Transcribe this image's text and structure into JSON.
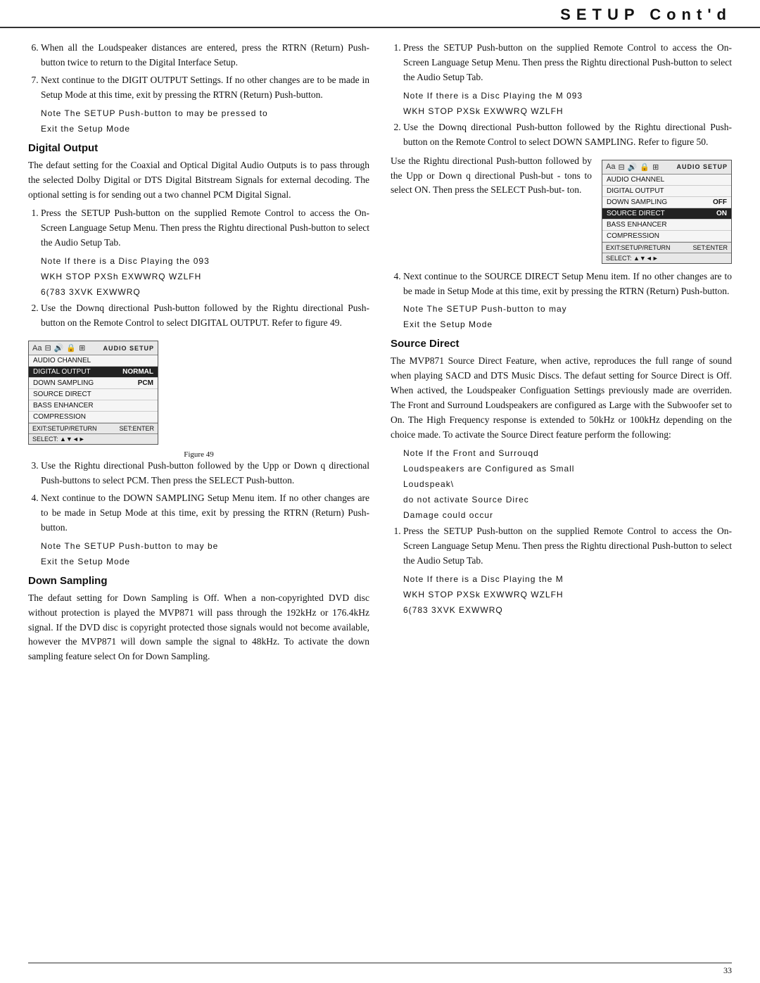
{
  "header": {
    "title": "SETUP  Cont'd"
  },
  "footer": {
    "page_number": "33"
  },
  "left_col": {
    "intro_items": [
      "When all the Loudspeaker distances are entered, press the RTRN (Return) Push-button twice to return to the Digital Interface Setup.",
      "Next continue to the DIGIT OUTPUT Settings. If no other changes are to be made in Setup Mode at this time, exit by pressing the RTRN (Return) Push-button."
    ],
    "note1_lines": [
      "Note  The SETUP Push-button to may be pressed to",
      "Exit the Setup Mode"
    ],
    "digital_output_heading": "Digital Output",
    "digital_output_body": "The defaut setting for the Coaxial and Optical Digital Audio Outputs is to pass through the selected Dolby Digital or DTS Digital Bitstream Signals for external decoding. The optional setting is for sending out a two channel PCM Digital Signal.",
    "steps_digital": [
      "Press the SETUP Push-button on the supplied Remote Control to access the On-Screen Language Setup Menu. Then press the Rightu directional Push-button to select the Audio Setup Tab.",
      "Use the Downq directional Push-button followed by the Rightu directional Push-button on the Remote Control to select DIGITAL OUTPUT. Refer to figure 49.",
      "Use the Rightu directional Push-button followed by the Upp or Down q directional Push-buttons to select PCM. Then press the SELECT Push-button.",
      "Next continue to the DOWN SAMPLING Setup Menu item. If no other changes are to be made in Setup Mode at this time, exit by pressing the RTRN (Return) Push-button."
    ],
    "note2_lines": [
      "Note  The SETUP Push-button to may be",
      "Exit the Setup Mode"
    ],
    "down_sampling_heading": "Down Sampling",
    "down_sampling_body": "The defaut setting for Down Sampling is Off. When a non-copyrighted DVD disc without protection is played the MVP871 will pass through the 192kHz or 176.4kHz signal. If the DVD disc is copyright protected those signals would not become available, however the MVP871 will down sample the signal to 48kHz. To activate the down sampling feature select On for Down Sampling.",
    "note1_detail_1": "Note  If there is a Disc Playing the 093",
    "note1_detail_2": "WKH STOP PXSh EXWWRQ WZLFH",
    "note1_detail_3": "6(783 3XVK EXWWRQ",
    "figure49_label": "Figure 49",
    "osd_left": {
      "header_label": "AUDIO SETUP",
      "rows": [
        {
          "label": "AUDIO CHANNEL",
          "value": "",
          "highlight": false
        },
        {
          "label": "DIGITAL OUTPUT",
          "value": "NORMAL",
          "highlight": true
        },
        {
          "label": "DOWN SAMPLING",
          "value": "PCM",
          "highlight": false
        },
        {
          "label": "SOURCE DIRECT",
          "value": "",
          "highlight": false
        },
        {
          "label": "BASS ENHANCER",
          "value": "",
          "highlight": false
        },
        {
          "label": "COMPRESSION",
          "value": "",
          "highlight": false
        }
      ],
      "footer_left": "EXIT:SETUP/RETURN",
      "footer_right": "SET:ENTER",
      "select_label": "SELECT: ▲▼◄►"
    }
  },
  "right_col": {
    "intro": "Press the SETUP Push-button on the supplied Remote Control to access the On-Screen Language Setup Menu. Then press the Rightu directional Push-button to select the Audio Setup Tab.",
    "note_r1_lines": [
      "Note  If there is a Disc Playing the M 093",
      "WKH STOP PXSk EXWWRQ WZLFH"
    ],
    "step2": "Use the Downq directional Push-button followed by the Rightu directional Push-button on the Remote Control to select DOWN SAMPLING. Refer to figure 50.",
    "step3": "Use the Rightu directional Push-button followed by the Upp or Down q directional Push-but - tons to select ON. Then press the SELECT Push-but- ton.",
    "step4": "Next continue to the SOURCE DIRECT Setup Menu item. If no other changes are to be made in Setup Mode at this time, exit by pressing the RTRN (Return) Push-button.",
    "note_r2_lines": [
      "Note  The SETUP Push-button to may",
      "Exit the Setup Mode"
    ],
    "source_direct_heading": "Source Direct",
    "source_direct_body": "The MVP871 Source Direct Feature, when active, reproduces the full range of sound when playing SACD and DTS Music Discs. The defaut setting for Source Direct is Off. When actived, the Loudspeaker Configuation Settings previously made are overriden. The Front and Surround Loudspeakers are configured as Large with the Subwoofer set to On. The High Frequency response is extended to 50kHz or 100kHz depending on the choice made. To activate the Source Direct feature perform the following:",
    "note_r3_lines": [
      "Note  If the Front and Surrouqd",
      "Loudspeakers are Configured as Small",
      "Loudspeak\\",
      "do not activate Source Direc",
      "Damage could occur"
    ],
    "step_r1": "Press the SETUP Push-button on the supplied Remote Control to access the On-Screen Language Setup Menu. Then press the Rightu directional Push-button to select the Audio Setup Tab.",
    "note_r4_lines": [
      "Note  If there is a Disc Playing the M",
      "WKH STOP PXSk EXWWRQ WZLFH",
      "6(783 3XVK EXWWRQ"
    ],
    "osd_right": {
      "header_label": "AUDIO SETUP",
      "rows": [
        {
          "label": "AUDIO CHANNEL",
          "value": "",
          "highlight": false
        },
        {
          "label": "DIGITAL OUTPUT",
          "value": "",
          "highlight": false
        },
        {
          "label": "DOWN SAMPLING",
          "value": "OFF",
          "highlight": false
        },
        {
          "label": "SOURCE DIRECT",
          "value": "ON",
          "highlight": true
        },
        {
          "label": "BASS ENHANCER",
          "value": "",
          "highlight": false
        },
        {
          "label": "COMPRESSION",
          "value": "",
          "highlight": false
        }
      ],
      "footer_left": "EXIT:SETUP/RETURN",
      "footer_right": "SET:ENTER",
      "select_label": "SELECT: ▲▼◄►"
    },
    "audio_channel_digital_output": "AUDIO CHANNEL DIGITAL OUTPUT",
    "bass_enhancer_compression": "BASS ENHANCER CompreSSion"
  }
}
